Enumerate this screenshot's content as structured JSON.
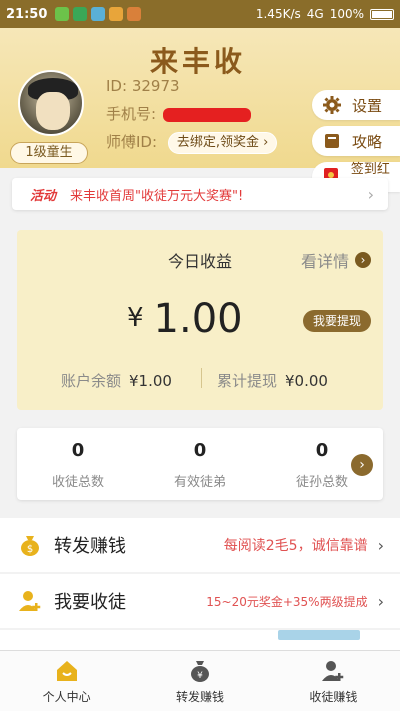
{
  "status_bar": {
    "time": "21:50",
    "network_speed": "1.45K/s",
    "network_type": "4G",
    "battery": "100%"
  },
  "app": {
    "logo_text": "来丰收"
  },
  "profile": {
    "level": "1级童生",
    "id_label": "ID:",
    "id_value": "32973",
    "phone_label": "手机号:",
    "master_label": "师傅ID:",
    "bind_button": "去绑定,领奖金"
  },
  "side_actions": {
    "settings": "设置",
    "guide": "攻略",
    "red_packet": "签到红包"
  },
  "activity": {
    "tag": "活动",
    "text": "来丰收首周\"收徒万元大奖赛\"!"
  },
  "earnings": {
    "title": "今日收益",
    "detail_link": "看详情",
    "currency": "¥",
    "amount": "1.00",
    "withdraw_button": "我要提现",
    "balance_label": "账户余额",
    "balance_value": "¥1.00",
    "withdrawn_label": "累计提现",
    "withdrawn_value": "¥0.00"
  },
  "stats": [
    {
      "value": "0",
      "label": "收徒总数"
    },
    {
      "value": "0",
      "label": "有效徒弟"
    },
    {
      "value": "0",
      "label": "徒孙总数"
    }
  ],
  "menu": [
    {
      "title": "转发赚钱",
      "note": "每阅读2毛5，诚信靠谱"
    },
    {
      "title": "我要收徒",
      "note": "15~20元奖金+35%两级提成"
    }
  ],
  "bottom_nav": [
    {
      "label": "个人中心"
    },
    {
      "label": "转发赚钱"
    },
    {
      "label": "收徒赚钱"
    }
  ],
  "colors": {
    "accent": "#8b6a2e",
    "header_bg": "#f3e1a4",
    "alert_red": "#e23a3a"
  }
}
